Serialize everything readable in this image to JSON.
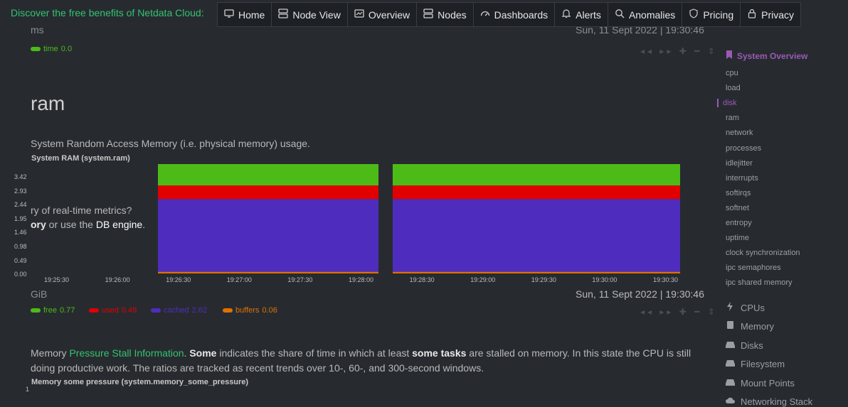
{
  "topbar": {
    "promo": "Discover the free benefits of Netdata Cloud:",
    "nav": [
      {
        "label": "Home",
        "icon": "monitor-icon"
      },
      {
        "label": "Node View",
        "icon": "node-view-icon"
      },
      {
        "label": "Overview",
        "icon": "overview-icon"
      },
      {
        "label": "Nodes",
        "icon": "nodes-icon"
      },
      {
        "label": "Dashboards",
        "icon": "dashboard-icon"
      },
      {
        "label": "Alerts",
        "icon": "bell-icon"
      },
      {
        "label": "Anomalies",
        "icon": "anomalies-icon"
      },
      {
        "label": "Pricing",
        "icon": "shield-icon"
      },
      {
        "label": "Privacy",
        "icon": "lock-icon"
      }
    ]
  },
  "prev_chart": {
    "unit": "ms",
    "timestamp": "Sun, 11 Sept 2022 | 19:30:46",
    "legend": [
      {
        "name": "time",
        "value": "0.0",
        "color": "#4cbb17"
      }
    ]
  },
  "section": {
    "title": "ram",
    "description": "System Random Access Memory (i.e. physical memory) usage."
  },
  "ram_chart": {
    "title": "System RAM (system.ram)",
    "unit": "GiB",
    "timestamp": "Sun, 11 Sept 2022 | 19:30:46",
    "overlay_line1": "ry of real-time metrics?",
    "overlay_bold": "ory",
    "overlay_line2_mid": " or use the ",
    "overlay_link": "DB engine",
    "overlay_line2_end": ".",
    "legend": [
      {
        "name": "free",
        "value": "0.77",
        "color": "#4cbb17"
      },
      {
        "name": "used",
        "value": "0.49",
        "color": "#e00000"
      },
      {
        "name": "cached",
        "value": "2.62",
        "color": "#4e2dbe"
      },
      {
        "name": "buffers",
        "value": "0.06",
        "color": "#e07000"
      }
    ]
  },
  "chart_data": {
    "type": "area",
    "title": "System RAM (system.ram)",
    "ylabel": "GiB",
    "yticks": [
      "3.42",
      "2.93",
      "2.44",
      "1.95",
      "1.46",
      "0.98",
      "0.49",
      "0.00"
    ],
    "ylim": [
      0,
      3.94
    ],
    "xticks": [
      "19:25:30",
      "19:26:00",
      "19:26:30",
      "19:27:00",
      "19:27:30",
      "19:28:00",
      "19:28:30",
      "19:29:00",
      "19:29:30",
      "19:30:00",
      "19:30:30"
    ],
    "series": [
      {
        "name": "buffers",
        "value": 0.06,
        "color": "#e07000"
      },
      {
        "name": "cached",
        "value": 2.62,
        "color": "#4e2dbe"
      },
      {
        "name": "used",
        "value": 0.49,
        "color": "#e00000"
      },
      {
        "name": "free",
        "value": 0.77,
        "color": "#4cbb17"
      }
    ],
    "segments": [
      {
        "start": "19:26:30",
        "end": "19:28:10"
      },
      {
        "start": "19:28:20",
        "end": "19:30:46"
      }
    ]
  },
  "pressure": {
    "desc_part1": "Memory ",
    "link": "Pressure Stall Information",
    "desc_part2": ". ",
    "bold1": "Some",
    "desc_part3": " indicates the share of time in which at least ",
    "bold2": "some tasks",
    "desc_part4": " are stalled on memory. In this state the CPU is still",
    "desc_line2": "doing productive work. The ratios are tracked as recent trends over 10-, 60-, and 300-second windows.",
    "chart_title": "Memory some pressure (system.memory_some_pressure)",
    "ytick_top": "1"
  },
  "sidebar": {
    "header": "System Overview",
    "subs": [
      "cpu",
      "load",
      "disk",
      "ram",
      "network",
      "processes",
      "idlejitter",
      "interrupts",
      "softirqs",
      "softnet",
      "entropy",
      "uptime",
      "clock synchronization",
      "ipc semaphores",
      "ipc shared memory"
    ],
    "active": "disk",
    "sections": [
      {
        "label": "CPUs",
        "icon": "bolt-icon"
      },
      {
        "label": "Memory",
        "icon": "memory-icon"
      },
      {
        "label": "Disks",
        "icon": "disk-icon"
      },
      {
        "label": "Filesystem",
        "icon": "filesystem-icon"
      },
      {
        "label": "Mount Points",
        "icon": "mount-icon"
      },
      {
        "label": "Networking Stack",
        "icon": "cloud-icon"
      }
    ]
  },
  "colors": {
    "accent": "#35c26e",
    "purple": "#9b59b6",
    "bg": "#272b30"
  }
}
